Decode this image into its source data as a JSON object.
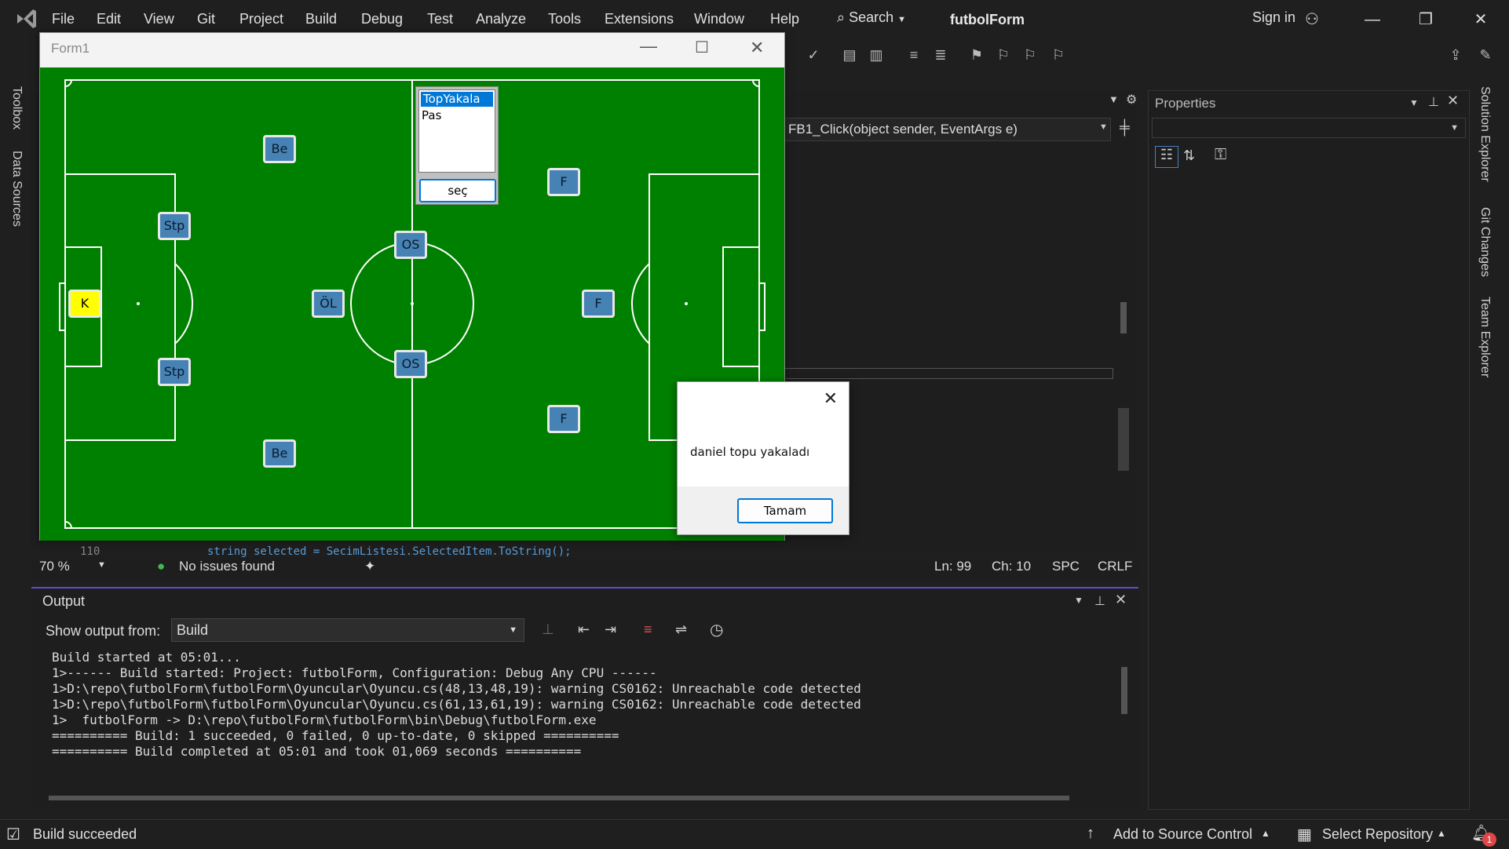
{
  "menu": [
    "File",
    "Edit",
    "View",
    "Git",
    "Project",
    "Build",
    "Debug",
    "Test",
    "Analyze",
    "Tools",
    "Extensions",
    "Window",
    "Help"
  ],
  "search_label": "Search",
  "solution_title": "futbolForm",
  "sign_in": "Sign in",
  "side_tabs_left": [
    "Toolbox",
    "Data Sources"
  ],
  "side_tabs_right": [
    "Solution Explorer",
    "Git Changes",
    "Team Explorer"
  ],
  "editor": {
    "method_dropdown": "FB1_Click(object sender, EventArgs e)",
    "line_number": "110",
    "code_line": "string selected = SecimListesi.SelectedItem.ToString();"
  },
  "editor_status": {
    "zoom": "70 %",
    "issues": "No issues found",
    "line": "Ln: 99",
    "col": "Ch: 10",
    "spacing": "SPC",
    "eol": "CRLF"
  },
  "properties": {
    "title": "Properties"
  },
  "output": {
    "title": "Output",
    "show_from_label": "Show output from:",
    "source": "Build",
    "lines": [
      "Build started at 05:01...",
      "1>------ Build started: Project: futbolForm, Configuration: Debug Any CPU ------",
      "1>D:\\repo\\futbolForm\\futbolForm\\Oyuncular\\Oyuncu.cs(48,13,48,19): warning CS0162: Unreachable code detected",
      "1>D:\\repo\\futbolForm\\futbolForm\\Oyuncular\\Oyuncu.cs(61,13,61,19): warning CS0162: Unreachable code detected",
      "1>  futbolForm -> D:\\repo\\futbolForm\\futbolForm\\bin\\Debug\\futbolForm.exe",
      "========== Build: 1 succeeded, 0 failed, 0 up-to-date, 0 skipped ==========",
      "========== Build completed at 05:01 and took 01,069 seconds =========="
    ]
  },
  "statusbar": {
    "build": "Build succeeded",
    "source_control": "Add to Source Control",
    "repository": "Select Repository",
    "notifications": "1"
  },
  "form": {
    "title": "Form1",
    "list_items": [
      "TopYakala",
      "Pas"
    ],
    "select_button": "seç",
    "players": {
      "gk": "K",
      "def_top": "Stp",
      "def_bottom": "Stp",
      "back_top": "Be",
      "back_bottom": "Be",
      "mid_left": "ÖL",
      "mid_top": "OS",
      "mid_bottom": "OS",
      "fwd_top": "F",
      "fwd_mid": "F",
      "fwd_bottom": "F"
    }
  },
  "message_box": {
    "text": "daniel topu yakaladı",
    "ok": "Tamam"
  },
  "colors": {
    "pitch": "#008000",
    "player": "#4682b4",
    "goalkeeper": "#ffff00",
    "accent": "#0078d7"
  }
}
